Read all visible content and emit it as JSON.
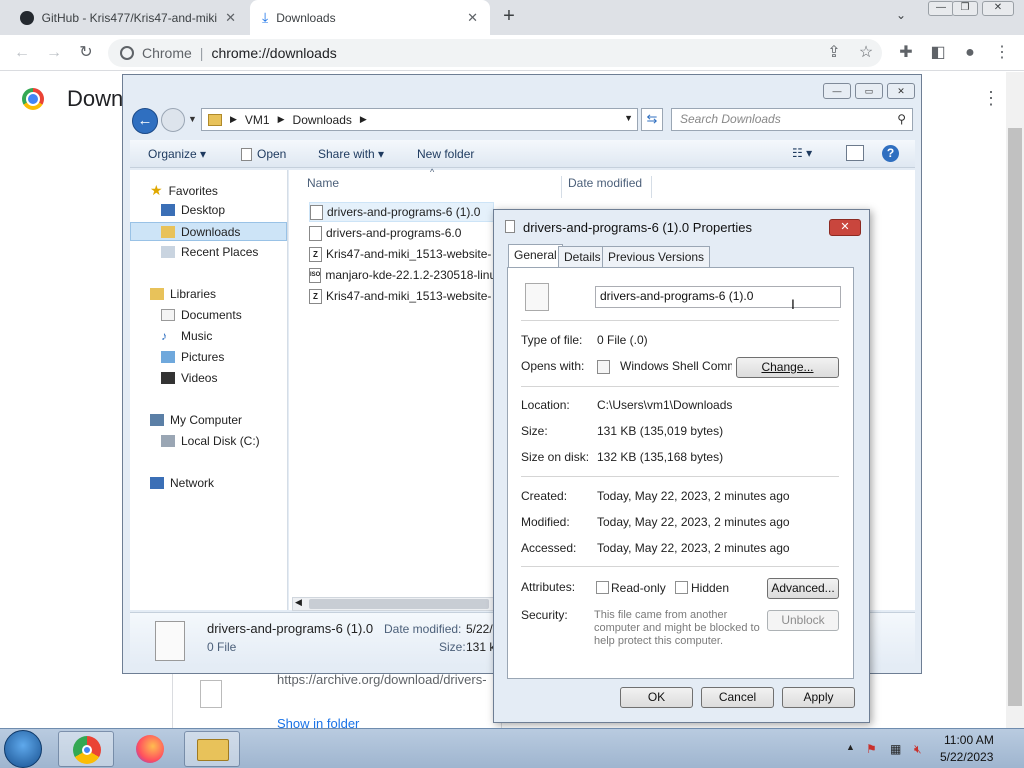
{
  "browser": {
    "tabs": [
      {
        "label": "GitHub - Kris477/Kris47-and-miki",
        "icon": "github-icon"
      },
      {
        "label": "Downloads",
        "icon": "download-icon"
      }
    ],
    "window_controls": [
      "minimize",
      "restore",
      "close"
    ],
    "omnibox": {
      "site": "Chrome",
      "url": "chrome://downloads"
    },
    "page": {
      "title": "Down",
      "download_url": "https://archive.org/download/drivers-",
      "show_in_folder": "Show in folder"
    }
  },
  "explorer": {
    "breadcrumb": [
      "VM1",
      "Downloads"
    ],
    "search_placeholder": "Search Downloads",
    "commands": {
      "organize": "Organize",
      "open": "Open",
      "share": "Share with",
      "new_folder": "New folder"
    },
    "nav": {
      "favorites": "Favorites",
      "desktop": "Desktop",
      "downloads": "Downloads",
      "recent": "Recent Places",
      "libraries": "Libraries",
      "documents": "Documents",
      "music": "Music",
      "pictures": "Pictures",
      "videos": "Videos",
      "computer": "My Computer",
      "local_disk": "Local Disk (C:)",
      "network": "Network"
    },
    "columns": {
      "name": "Name",
      "date": "Date modified"
    },
    "files": [
      {
        "name": "drivers-and-programs-6 (1).0",
        "icon": ""
      },
      {
        "name": "drivers-and-programs-6.0",
        "icon": ""
      },
      {
        "name": "Kris47-and-miki_1513-website-",
        "icon": "Z"
      },
      {
        "name": "manjaro-kde-22.1.2-230518-linu",
        "icon": "ISO"
      },
      {
        "name": "Kris47-and-miki_1513-website-",
        "icon": "Z"
      }
    ],
    "details": {
      "name": "drivers-and-programs-6 (1).0",
      "type": "0 File",
      "date_label": "Date modified:",
      "date_value": "5/22/",
      "size_label": "Size:",
      "size_value": "131 k"
    }
  },
  "properties": {
    "title": "drivers-and-programs-6 (1).0 Properties",
    "tabs": [
      "General",
      "Details",
      "Previous Versions"
    ],
    "filename": "drivers-and-programs-6 (1).0",
    "type_label": "Type of file:",
    "type_value": "0 File (.0)",
    "opens_label": "Opens with:",
    "opens_value": "Windows Shell Commor",
    "change_button": "Change...",
    "location_label": "Location:",
    "location_value": "C:\\Users\\vm1\\Downloads",
    "size_label": "Size:",
    "size_value": "131 KB (135,019 bytes)",
    "disk_label": "Size on disk:",
    "disk_value": "132 KB (135,168 bytes)",
    "created_label": "Created:",
    "created_value": "Today, May 22, 2023, 2 minutes ago",
    "modified_label": "Modified:",
    "modified_value": "Today, May 22, 2023, 2 minutes ago",
    "accessed_label": "Accessed:",
    "accessed_value": "Today, May 22, 2023, 2 minutes ago",
    "attributes_label": "Attributes:",
    "readonly": "Read-only",
    "hidden": "Hidden",
    "advanced_button": "Advanced...",
    "security_label": "Security:",
    "security_text": "This file came from another computer and might be blocked to help protect this computer.",
    "unblock_button": "Unblock",
    "ok_button": "OK",
    "cancel_button": "Cancel",
    "apply_button": "Apply"
  },
  "taskbar": {
    "apps": [
      "chrome-icon",
      "firefox-icon",
      "explorer-icon"
    ],
    "time": "11:00 AM",
    "date": "5/22/2023"
  }
}
